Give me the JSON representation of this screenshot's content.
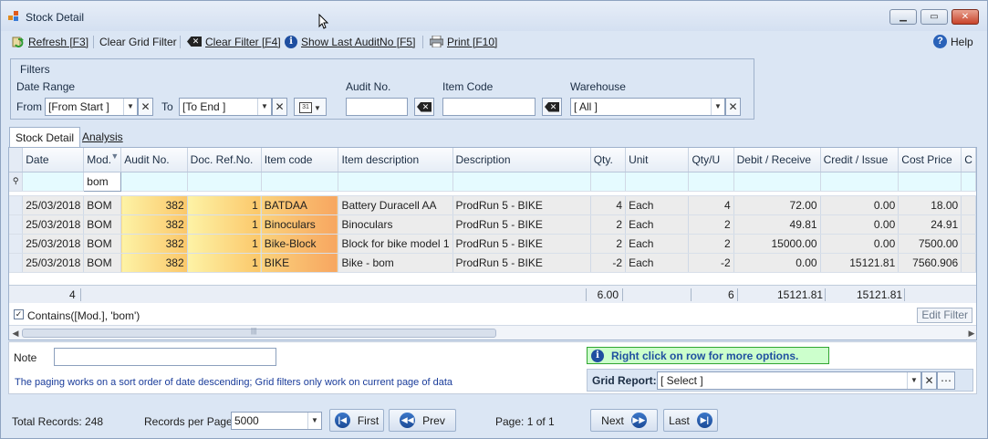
{
  "window": {
    "title": "Stock Detail"
  },
  "toolbar": {
    "refresh": "Refresh [F3]",
    "clear_grid_filter": "Clear Grid Filter",
    "clear_filter": "Clear Filter [F4]",
    "show_last_audit": "Show Last AuditNo [F5]",
    "print": "Print [F10]",
    "help": "Help"
  },
  "filters": {
    "legend": "Filters",
    "date_range_label": "Date Range",
    "from_label": "From",
    "from_value": "[From Start ]",
    "to_label": "To",
    "to_value": "[To End ]",
    "audit_label": "Audit No.",
    "audit_value": "",
    "item_code_label": "Item Code",
    "item_code_value": "",
    "warehouse_label": "Warehouse",
    "warehouse_value": "[ All ]"
  },
  "tabs": [
    {
      "label": "Stock Detail",
      "active": true
    },
    {
      "label": "Analysis",
      "active": false
    }
  ],
  "grid": {
    "columns": [
      "Date",
      "Mod.",
      "Audit No.",
      "Doc. Ref.No.",
      "Item code",
      "Item description",
      "Description",
      "Qty.",
      "Unit",
      "Qty/U",
      "Debit / Receive",
      "Credit / Issue",
      "Cost Price",
      "C"
    ],
    "filter_mod": "bom",
    "rows": [
      [
        "25/03/2018",
        "BOM",
        "382",
        "1",
        "BATDAA",
        "Battery Duracell AA",
        "ProdRun 5 - BIKE",
        "4",
        "Each",
        "4",
        "72.00",
        "0.00",
        "18.00"
      ],
      [
        "25/03/2018",
        "BOM",
        "382",
        "1",
        "Binoculars",
        "Binoculars",
        "ProdRun 5 - BIKE",
        "2",
        "Each",
        "2",
        "49.81",
        "0.00",
        "24.91"
      ],
      [
        "25/03/2018",
        "BOM",
        "382",
        "1",
        "Bike-Block",
        "Block for bike model 1",
        "ProdRun 5 - BIKE",
        "2",
        "Each",
        "2",
        "15000.00",
        "0.00",
        "7500.00"
      ],
      [
        "25/03/2018",
        "BOM",
        "382",
        "1",
        "BIKE",
        "Bike - bom",
        "ProdRun 5 - BIKE",
        "-2",
        "Each",
        "-2",
        "0.00",
        "15121.81",
        "7560.906"
      ]
    ],
    "footer": {
      "count": "4",
      "qty": "6.00",
      "qtyu": "6",
      "debit": "15121.81",
      "credit": "15121.81"
    },
    "filter_expression": "Contains([Mod.], 'bom')",
    "edit_filter": "Edit Filter"
  },
  "lower": {
    "note_label": "Note",
    "note_value": "",
    "paging_notice": "The paging works on a sort order of date descending; Grid filters only work on current page of data",
    "right_click_hint": "Right click on row for more options.",
    "grid_report_label": "Grid Report:",
    "grid_report_value": "[ Select ]"
  },
  "paging": {
    "total_records": "Total Records: 248",
    "records_per_page_label": "Records per Page:",
    "records_per_page_value": "5000",
    "first": "First",
    "prev": "Prev",
    "page_info": "Page: 1 of 1",
    "next": "Next",
    "last": "Last"
  }
}
